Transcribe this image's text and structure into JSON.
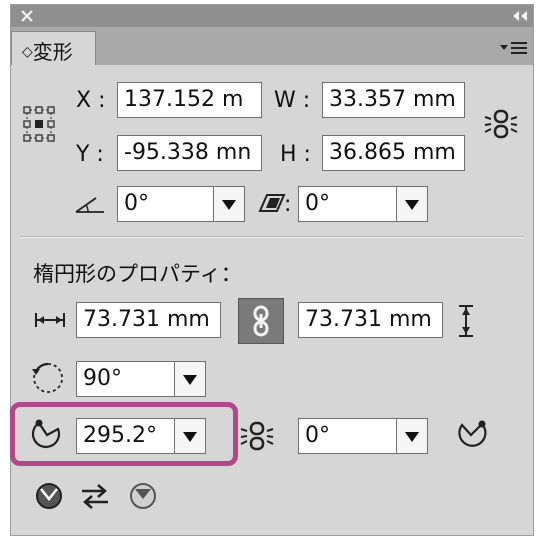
{
  "panel": {
    "tab_label": "変形",
    "tab_chevron": "◇"
  },
  "transform": {
    "x_label": "X :",
    "x_value": "137.152 m",
    "y_label": "Y :",
    "y_value": "-95.338 mn",
    "w_label": "W :",
    "w_value": "33.357 mm",
    "h_label": "H :",
    "h_value": "36.865 mm",
    "rotate_value": "0°",
    "shear_label": ":",
    "shear_value": "0°"
  },
  "ellipse": {
    "heading": "楕円形のプロパティ：",
    "width_value": "73.731 mm",
    "height_value": "73.731 mm",
    "rotation_value": "90°",
    "pie_start_value": "295.2°",
    "pie_end_value": "0°"
  },
  "highlight_color": "#b0498b",
  "icons": [
    "close-icon",
    "collapse-icon",
    "panel-menu-icon",
    "reference-point-icon",
    "constrain-link-icon",
    "rotate-angle-icon",
    "shear-icon",
    "ellipse-width-icon",
    "ellipse-height-icon",
    "link-icon",
    "ellipse-rotate-icon",
    "pie-start-icon",
    "pie-link-icon",
    "pie-end-icon",
    "pie-invert-icon",
    "swap-icon",
    "pie-outline-icon"
  ]
}
